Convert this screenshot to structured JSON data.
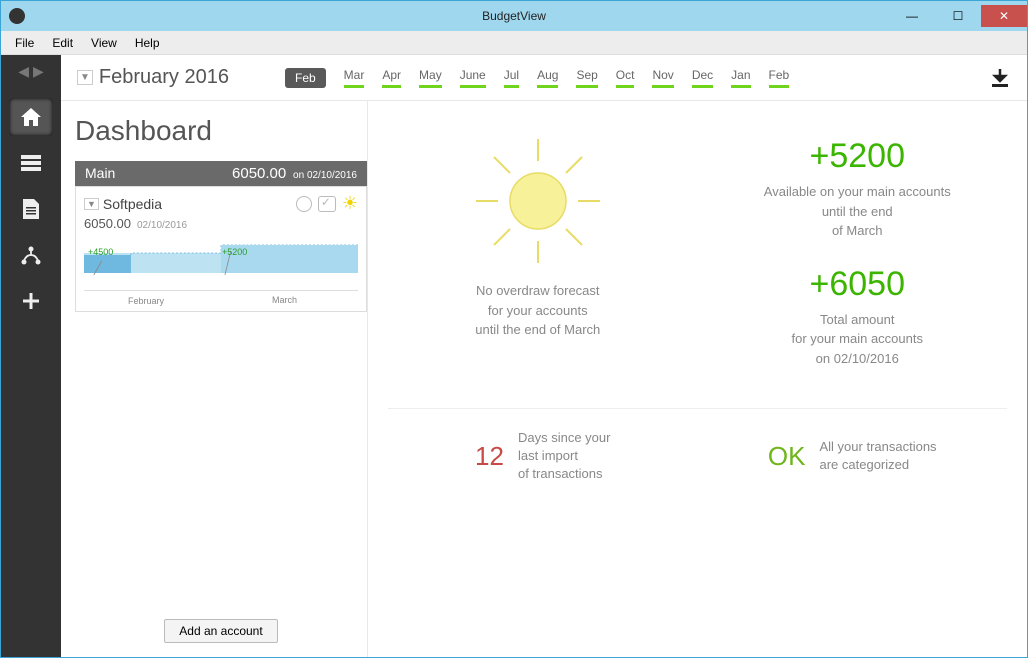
{
  "window": {
    "title": "BudgetView"
  },
  "menu": {
    "file": "File",
    "edit": "Edit",
    "view": "View",
    "help": "Help"
  },
  "monthbar": {
    "current_label": "February 2016",
    "tabs": [
      "Feb",
      "Mar",
      "Apr",
      "May",
      "June",
      "Jul",
      "Aug",
      "Sep",
      "Oct",
      "Nov",
      "Dec",
      "Jan",
      "Feb"
    ],
    "current_index": 0
  },
  "dashboard": {
    "title": "Dashboard",
    "account_group": {
      "name": "Main",
      "amount": "6050.00",
      "date_prefix": "on",
      "date": "02/10/2016"
    },
    "account": {
      "name": "Softpedia",
      "amount": "6050.00",
      "date": "02/10/2016",
      "spark": {
        "v1": "+4500",
        "v2": "+5200",
        "m1": "February",
        "m2": "March"
      }
    },
    "add_button": "Add an account"
  },
  "forecast": {
    "line1": "No overdraw forecast",
    "line2": "for your accounts",
    "line3": "until the end of March"
  },
  "available": {
    "value": "+5200",
    "line1": "Available on your main accounts",
    "line2": "until the end",
    "line3": "of March"
  },
  "total": {
    "value": "+6050",
    "line1": "Total amount",
    "line2": "for your main accounts",
    "line3": "on 02/10/2016"
  },
  "status_days": {
    "value": "12",
    "line1": "Days since your",
    "line2": "last import",
    "line3": "of transactions"
  },
  "status_ok": {
    "value": "OK",
    "line1": "All your transactions",
    "line2": "are categorized"
  }
}
